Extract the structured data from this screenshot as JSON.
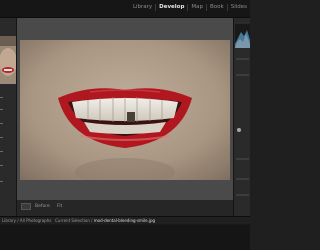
{
  "modules": [
    "Library",
    "Develop",
    "Map",
    "Book",
    "Slides"
  ],
  "active_module": "Develop",
  "status": {
    "prefix": "Library / All Photographs",
    "middle": "Current Selection",
    "filename": "mod-dental-bleeding-smile.jpg"
  },
  "toolbar": {
    "view_label": "Before",
    "zoom_label": "Fit"
  },
  "colors": {
    "accent_blue": "#5aa0d0",
    "lip_red": "#b0171f",
    "skin": "#a99682"
  }
}
